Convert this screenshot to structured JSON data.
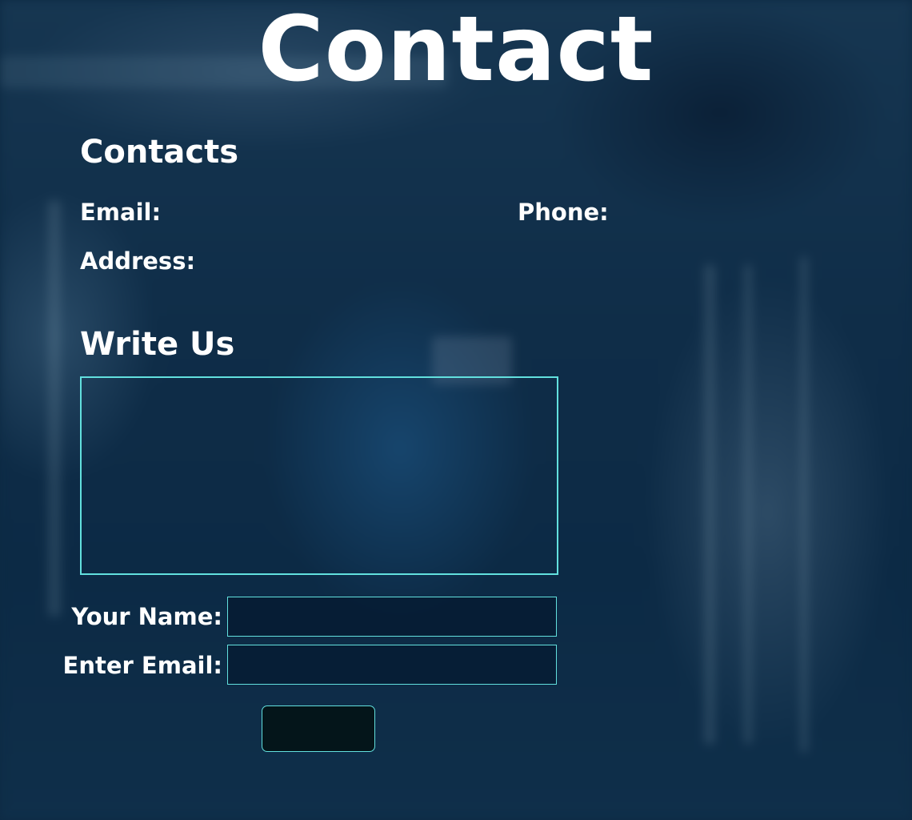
{
  "page": {
    "title": "Contact"
  },
  "contacts": {
    "heading": "Contacts",
    "email_label": "Email:",
    "phone_label": "Phone:",
    "address_label": "Address:"
  },
  "write_us": {
    "heading": "Write Us",
    "message_value": "",
    "name_label": "Your Name:",
    "name_value": "",
    "email_label": "Enter Email:",
    "email_value": "",
    "submit_label": ""
  },
  "colors": {
    "accent": "#62e0de",
    "background": "#0d2a44",
    "button_bg": "#04151a",
    "text": "#ffffff"
  }
}
